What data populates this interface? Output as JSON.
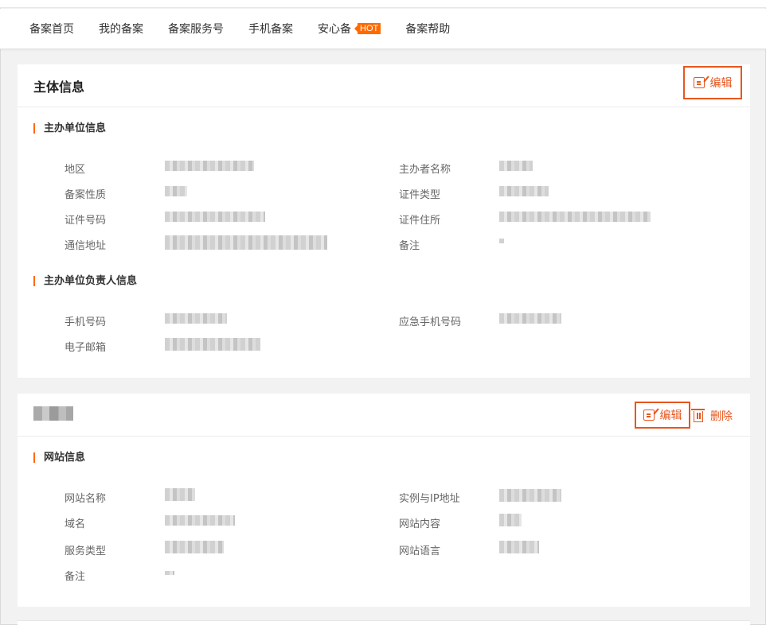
{
  "nav": {
    "items": [
      {
        "label": "备案首页"
      },
      {
        "label": "我的备案"
      },
      {
        "label": "备案服务号"
      },
      {
        "label": "手机备案"
      },
      {
        "label": "安心备",
        "badge": "HOT"
      },
      {
        "label": "备案帮助"
      }
    ],
    "accent_color": "#ff6a00"
  },
  "subject": {
    "title": "主体信息",
    "edit_label": "编辑",
    "sponsor_section": "主办单位信息",
    "fields": {
      "region": "地区",
      "sponsor_name": "主办者名称",
      "nature": "备案性质",
      "cert_type": "证件类型",
      "cert_number": "证件号码",
      "cert_address": "证件住所",
      "mail_address": "通信地址",
      "remark": "备注"
    },
    "contact_section": "主办单位负责人信息",
    "contact_fields": {
      "mobile": "手机号码",
      "emergency_mobile": "应急手机号码",
      "email": "电子邮箱"
    }
  },
  "website": {
    "edit_label": "编辑",
    "delete_label": "删除",
    "section": "网站信息",
    "fields": {
      "site_name": "网站名称",
      "instance_ip": "实例与IP地址",
      "domain": "域名",
      "site_content": "网站内容",
      "service_type": "服务类型",
      "site_language": "网站语言",
      "remark": "备注"
    }
  },
  "highlight_color": "#e8561e"
}
